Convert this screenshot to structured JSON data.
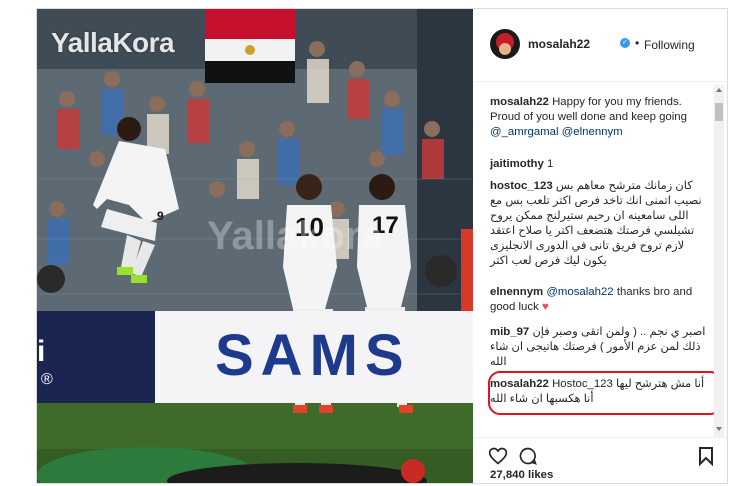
{
  "photo": {
    "watermark": "YallaKora",
    "watermark_faint": "Yallakora",
    "ad_text": "SAMS",
    "ad_left_text": "i",
    "ad_left_reg": "®",
    "jersey_numbers": [
      "10",
      "17",
      "9"
    ],
    "colors": {
      "pitch": "#3f6b2a",
      "ad_blue": "#1d3a8c",
      "crowd": "#55606b"
    }
  },
  "header": {
    "username": "mosalah22",
    "verified_icon": "✓",
    "separator": "•",
    "follow_status": "Following"
  },
  "comments": [
    {
      "user": "mosalah22",
      "text": "Happy for you my friends. Proud of you well done and keep going",
      "mentions": [
        "@_amrgamal",
        "@elnennym"
      ]
    },
    {
      "user": "jaitimothy",
      "text": "1"
    },
    {
      "user": "hostoc_123",
      "text": "كان زمانك مترشح معاهم بس نصيب اتمنى انك تاخد فرص اكتر تلعب بس مع اللى سامعينه ان رحيم ستيرلنج ممكن يروح تشيلسي فرصتك هتضعف اكتر يا صلاح اعتقد لازم تروح فريق تانى في الدورى الانجليزى يكون ليك فرص لعب اكتر"
    },
    {
      "user": "elnennym",
      "mention": "@mosalah22",
      "text": "thanks bro and good luck",
      "heart": "♥"
    },
    {
      "user": "mib_97",
      "text": "اصبر ي نجم .. ( ولمن اتقى وصبر فإن ذلك لمن عزم الأمور ) فرصتك هاتيجى ان شاء الله"
    },
    {
      "user": "mosalah22",
      "mention": "Hostoc_123",
      "text": "أنا مش هترشح ليها أنا هكسبها ان شاء الله"
    }
  ],
  "actions": {
    "like_icon": "heart-outline-icon",
    "comment_icon": "comment-bubble-icon",
    "save_icon": "bookmark-icon"
  },
  "likes": "27,840 likes",
  "highlight_color": "#e0141e"
}
